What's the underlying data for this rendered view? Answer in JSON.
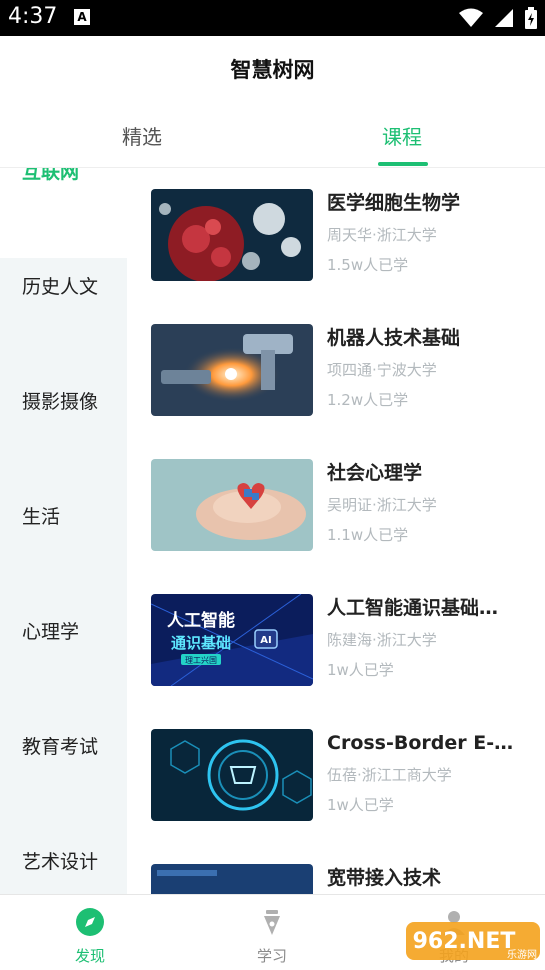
{
  "status_bar": {
    "time": "4:37",
    "notification_icon": "a-box-icon"
  },
  "app": {
    "title": "智慧树网",
    "accent": "#1dbf73"
  },
  "tabs": [
    {
      "label": "精选",
      "active": false
    },
    {
      "label": "课程",
      "active": true
    }
  ],
  "categories": [
    {
      "label": "互联网",
      "active": true
    },
    {
      "label": "历史人文",
      "active": false
    },
    {
      "label": "摄影摄像",
      "active": false
    },
    {
      "label": "生活",
      "active": false
    },
    {
      "label": "心理学",
      "active": false
    },
    {
      "label": "教育考试",
      "active": false
    },
    {
      "label": "艺术设计",
      "active": false
    }
  ],
  "courses": [
    {
      "title": "医学细胞生物学",
      "teacher": "周天华·浙江大学",
      "learners": "1.5w人已学",
      "thumb": "virus-image"
    },
    {
      "title": "机器人技术基础",
      "teacher": "项四通·宁波大学",
      "learners": "1.2w人已学",
      "thumb": "robot-image"
    },
    {
      "title": "社会心理学",
      "teacher": "吴明证·浙江大学",
      "learners": "1.1w人已学",
      "thumb": "hands-image"
    },
    {
      "title": "人工智能通识基础…",
      "teacher": "陈建海·浙江大学",
      "learners": "1w人已学",
      "thumb": "ai-banner-image",
      "thumb_text": [
        "人工智能",
        "通识基础",
        "理工兴国"
      ]
    },
    {
      "title": "Cross-Border E-co…",
      "teacher": "伍蓓·浙江工商大学",
      "learners": "1w人已学",
      "thumb": "ecommerce-image"
    },
    {
      "title": "宽带接入技术",
      "teacher": "",
      "learners": "",
      "thumb": "broadband-image"
    }
  ],
  "bottom_nav": [
    {
      "label": "发现",
      "icon": "compass-icon",
      "active": true
    },
    {
      "label": "学习",
      "icon": "pen-nib-icon",
      "active": false
    },
    {
      "label": "我的",
      "icon": "person-icon",
      "active": false
    }
  ],
  "watermark": {
    "text": "962.NET",
    "subtext": "乐游网"
  }
}
